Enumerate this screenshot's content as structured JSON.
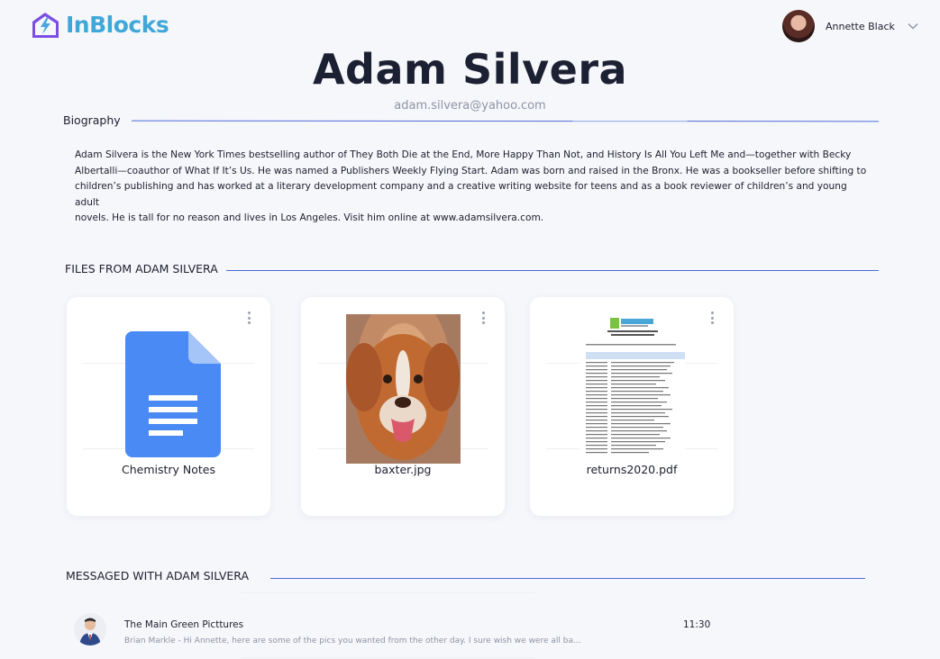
{
  "brand": {
    "name": "InBlocks",
    "logo_icon": "mailbox-bolt-icon",
    "accent": "#3fa8d8",
    "logo_color": "#7b4ee4"
  },
  "user": {
    "name": "Annette Black",
    "dropdown_icon": "chevron-down-icon"
  },
  "profile": {
    "name": "Adam Silvera",
    "email": "adam.silvera@yahoo.com"
  },
  "biography": {
    "heading": "Biography",
    "lines": [
      "Adam Silvera is the New York Times bestselling author of They Both Die at the End, More Happy Than Not, and History Is All You Left Me and—together with Becky",
      "Albertalli—coauthor of What If It’s Us. He was named a Publishers Weekly Flying Start. Adam was born and raised in the Bronx. He was a bookseller before shifting to",
      "children’s publishing and has worked at a literary development company and a creative writing website for teens and as a book reviewer of children’s and young adult",
      "novels. He is tall for no reason and lives in Los Angeles. Visit him online at www.adamsilvera.com."
    ]
  },
  "files": {
    "heading": "FILES FROM ADAM SILVERA",
    "items": [
      {
        "name": "Chemistry Notes",
        "icon": "google-docs-icon",
        "menu_icon": "more-vertical-icon"
      },
      {
        "name": "baxter.jpg",
        "icon": "dog-photo-thumbnail",
        "menu_icon": "more-vertical-icon"
      },
      {
        "name": "returns2020.pdf",
        "icon": "pdf-document-thumbnail",
        "menu_icon": "more-vertical-icon"
      }
    ]
  },
  "messages": {
    "heading": "MESSAGED WITH ADAM SILVERA",
    "items": [
      {
        "title": "The Main Green Picttures",
        "preview": "Brian Markle - Hi Annette, here are some of the pics you wanted from the other day. I sure wish we were all ba...",
        "time": "11:30"
      }
    ]
  },
  "colors": {
    "background": "#f6f7fb",
    "divider": "#4b6bd8",
    "text": "#1d1f2e",
    "muted": "#8e93a6",
    "docs_blue": "#4a8af4"
  }
}
